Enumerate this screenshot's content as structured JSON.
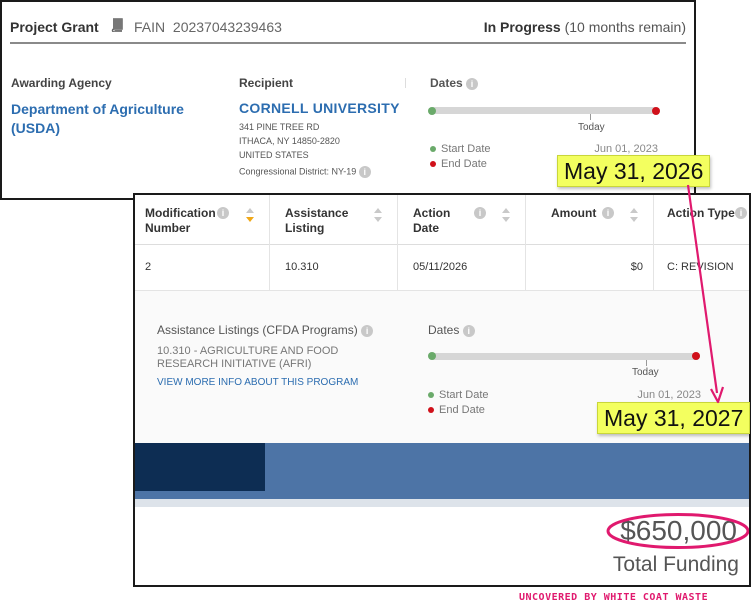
{
  "grant": {
    "type_label": "Project Grant",
    "fain_label": "FAIN",
    "fain_value": "20237043239463",
    "status": "In Progress",
    "status_note": "(10 months remain)",
    "icon": "book-icon"
  },
  "awarding_agency": {
    "label": "Awarding Agency",
    "name": "Department of Agriculture (USDA)"
  },
  "recipient": {
    "label": "Recipient",
    "name": "CORNELL UNIVERSITY",
    "address_line1": "341 PINE TREE RD",
    "address_line2": "ITHACA, NY 14850-2820",
    "address_line3": "UNITED STATES",
    "district": "Congressional District: NY-19"
  },
  "dates_top": {
    "label": "Dates",
    "today_label": "Today",
    "start_label": "Start Date",
    "start_value": "Jun 01, 2023",
    "end_label": "End Date",
    "today_fraction": 0.72
  },
  "annotation_top": {
    "text": "May 31, 2026"
  },
  "table": {
    "columns": [
      "Modification Number",
      "Assistance Listing",
      "Action Date",
      "Amount",
      "Action Type"
    ],
    "row": {
      "modification_number": "2",
      "assistance_listing": "10.310",
      "action_date": "05/11/2026",
      "amount": "$0",
      "action_type": "C: REVISION"
    }
  },
  "cfda": {
    "title": "Assistance Listings (CFDA Programs)",
    "text": "10.310 - AGRICULTURE AND FOOD RESEARCH INITIATIVE (AFRI)",
    "link": "VIEW MORE INFO ABOUT THIS PROGRAM"
  },
  "dates_bottom": {
    "label": "Dates",
    "today_label": "Today",
    "start_label": "Start Date",
    "start_value": "Jun 01, 2023",
    "end_label": "End Date",
    "today_fraction": 0.82
  },
  "annotation_bottom": {
    "text": "May 31, 2027"
  },
  "funding": {
    "amount": "$650,000",
    "label": "Total Funding"
  },
  "credit": "UNCOVERED BY WHITE COAT WASTE",
  "colors": {
    "link": "#2c6db0",
    "start_dot": "#6aaa6a",
    "end_dot": "#d0101a",
    "highlight": "#f3ff5f",
    "annotation_pink": "#e0196e",
    "band_dark": "#0d2d53",
    "band_light": "#4d74a6"
  }
}
